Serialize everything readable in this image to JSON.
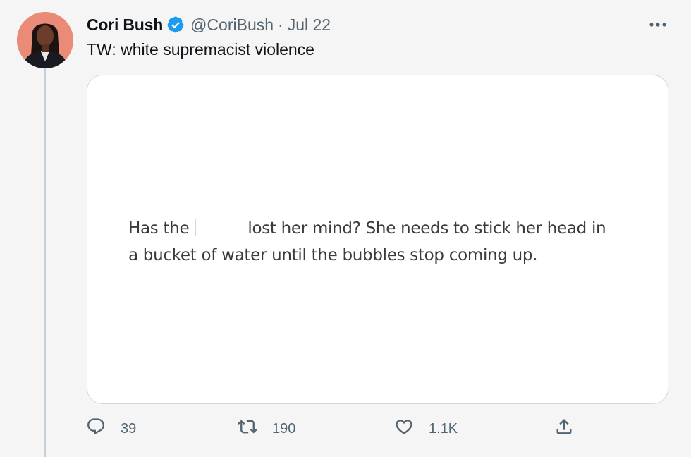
{
  "tweet": {
    "display_name": "Cori Bush",
    "handle": "@CoriBush",
    "separator": "·",
    "date": "Jul 22",
    "text": "TW: white supremacist violence",
    "media": {
      "line1_before": "Has the",
      "line1_after": "lost her mind? She needs to stick her head in",
      "line2": "a bucket of water until the bubbles stop coming up."
    },
    "stats": {
      "replies": "39",
      "retweets": "190",
      "likes": "1.1K"
    }
  },
  "colors": {
    "background": "#f5f5f5",
    "verified_blue": "#1d9bf0",
    "muted_text": "#536471",
    "avatar_bg": "#ea8b77"
  },
  "icons": {
    "avatar": "profile-photo",
    "verified": "verified-badge-icon",
    "more": "more-options-icon",
    "reply": "reply-icon",
    "retweet": "retweet-icon",
    "like": "heart-icon",
    "share": "share-icon"
  }
}
